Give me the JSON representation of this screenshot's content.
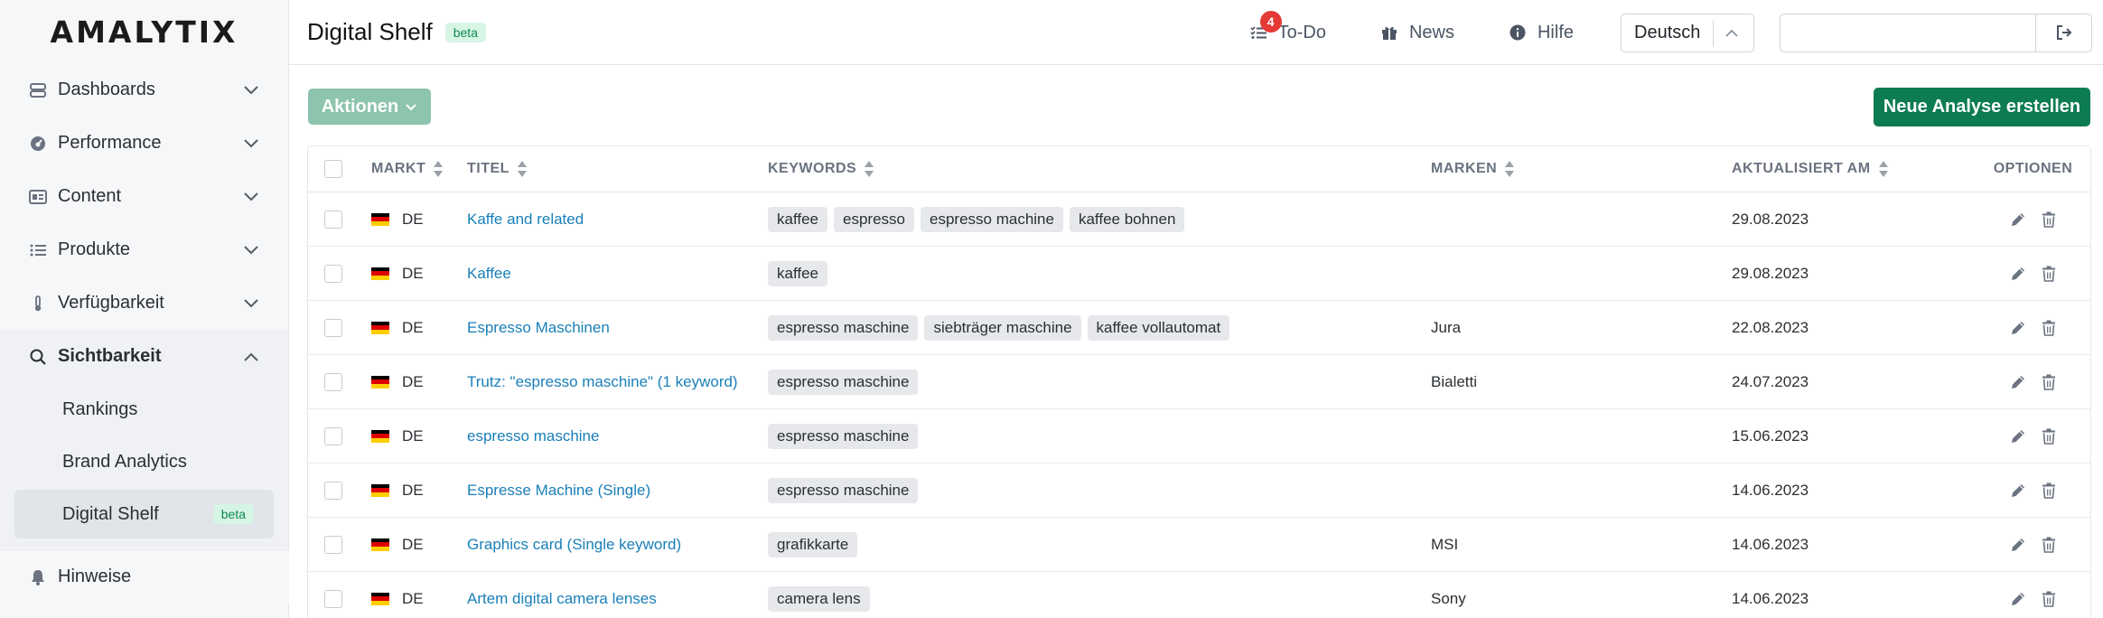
{
  "brand": {
    "logo_text": "AMALYTIX"
  },
  "sidebar": {
    "items": [
      {
        "label": "Dashboards",
        "icon": "dashboard-icon"
      },
      {
        "label": "Performance",
        "icon": "performance-icon"
      },
      {
        "label": "Content",
        "icon": "content-icon"
      },
      {
        "label": "Produkte",
        "icon": "list-icon"
      },
      {
        "label": "Verfügbarkeit",
        "icon": "thermometer-icon"
      },
      {
        "label": "Sichtbarkeit",
        "icon": "search-icon",
        "open": true
      }
    ],
    "subitems": [
      {
        "label": "Rankings"
      },
      {
        "label": "Brand Analytics"
      },
      {
        "label": "Digital Shelf",
        "badge": "beta",
        "active": true
      }
    ],
    "hinweise": {
      "label": "Hinweise",
      "icon": "bell-icon"
    }
  },
  "header": {
    "title": "Digital Shelf",
    "title_badge": "beta",
    "todo": {
      "label": "To-Do",
      "count": "4"
    },
    "news": {
      "label": "News"
    },
    "hilfe": {
      "label": "Hilfe"
    },
    "language": {
      "value": "Deutsch"
    },
    "account": {
      "value": ""
    }
  },
  "toolbar": {
    "actions_label": "Aktionen",
    "create_label": "Neue Analyse erstellen"
  },
  "table": {
    "columns": {
      "markt": "MARKT",
      "titel": "TITEL",
      "keywords": "KEYWORDS",
      "marken": "MARKEN",
      "date": "AKTUALISIERT AM",
      "options": "OPTIONEN"
    },
    "rows": [
      {
        "markt": "DE",
        "titel": "Kaffe and related",
        "keywords": [
          "kaffee",
          "espresso",
          "espresso machine",
          "kaffee bohnen"
        ],
        "marken": "",
        "date": "29.08.2023"
      },
      {
        "markt": "DE",
        "titel": "Kaffee",
        "keywords": [
          "kaffee"
        ],
        "marken": "",
        "date": "29.08.2023"
      },
      {
        "markt": "DE",
        "titel": "Espresso Maschinen",
        "keywords": [
          "espresso maschine",
          "siebträger maschine",
          "kaffee vollautomat"
        ],
        "marken": "Jura",
        "date": "22.08.2023"
      },
      {
        "markt": "DE",
        "titel": "Trutz: \"espresso maschine\" (1 keyword)",
        "keywords": [
          "espresso maschine"
        ],
        "marken": "Bialetti",
        "date": "24.07.2023"
      },
      {
        "markt": "DE",
        "titel": "espresso maschine",
        "keywords": [
          "espresso maschine"
        ],
        "marken": "",
        "date": "15.06.2023"
      },
      {
        "markt": "DE",
        "titel": "Espresse Machine (Single)",
        "keywords": [
          "espresso maschine"
        ],
        "marken": "",
        "date": "14.06.2023"
      },
      {
        "markt": "DE",
        "titel": "Graphics card (Single keyword)",
        "keywords": [
          "grafikkarte"
        ],
        "marken": "MSI",
        "date": "14.06.2023"
      },
      {
        "markt": "DE",
        "titel": "Artem digital camera lenses",
        "keywords": [
          "camera lens"
        ],
        "marken": "Sony",
        "date": "14.06.2023"
      }
    ]
  },
  "colors": {
    "primary": "#0d7c53",
    "primary_disabled": "#8dc4ad",
    "link": "#1a7fb8",
    "badge_bg": "#d7f5e5",
    "badge_text": "#0f8a4f",
    "notification": "#e53935"
  }
}
